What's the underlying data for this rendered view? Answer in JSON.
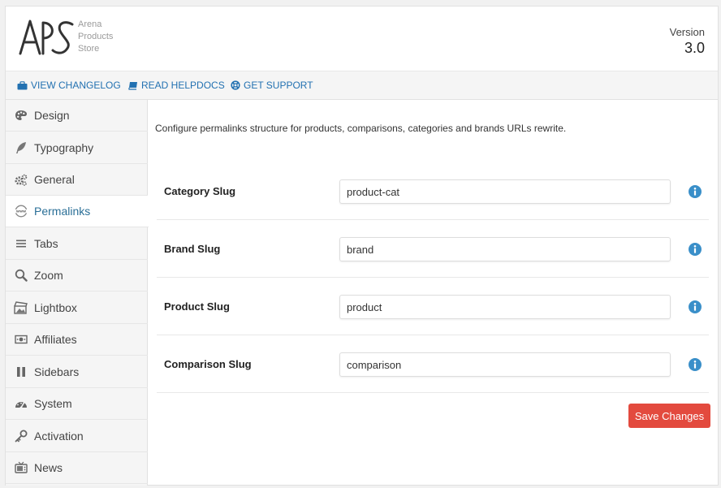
{
  "header": {
    "logo_text": [
      "Arena",
      "Products",
      "Store"
    ],
    "version_label": "Version",
    "version_number": "3.0"
  },
  "toolbar": {
    "links": [
      {
        "label": "VIEW CHANGELOG",
        "icon": "briefcase-icon"
      },
      {
        "label": "READ HELPDOCS",
        "icon": "book-icon"
      },
      {
        "label": "GET SUPPORT",
        "icon": "lifebuoy-icon"
      }
    ]
  },
  "sidebar": {
    "items": [
      {
        "label": "Design",
        "icon": "palette-icon"
      },
      {
        "label": "Typography",
        "icon": "feather-icon"
      },
      {
        "label": "General",
        "icon": "gears-icon"
      },
      {
        "label": "Permalinks",
        "icon": "www-icon",
        "active": true
      },
      {
        "label": "Tabs",
        "icon": "list-icon"
      },
      {
        "label": "Zoom",
        "icon": "magnifier-icon"
      },
      {
        "label": "Lightbox",
        "icon": "lightbox-icon"
      },
      {
        "label": "Affiliates",
        "icon": "money-icon"
      },
      {
        "label": "Sidebars",
        "icon": "columns-icon"
      },
      {
        "label": "System",
        "icon": "dashboard-icon"
      },
      {
        "label": "Activation",
        "icon": "key-icon"
      },
      {
        "label": "News",
        "icon": "tv-icon"
      }
    ]
  },
  "main": {
    "intro": "Configure permalinks structure for products, comparisons, categories and brands URLs rewrite.",
    "fields": [
      {
        "label": "Category Slug",
        "value": "product-cat"
      },
      {
        "label": "Brand Slug",
        "value": "brand"
      },
      {
        "label": "Product Slug",
        "value": "product"
      },
      {
        "label": "Comparison Slug",
        "value": "comparison"
      }
    ],
    "save_label": "Save Changes"
  },
  "colors": {
    "accent": "#2271b1",
    "active_nav": "#2a6f97",
    "save_button": "#e34a3e",
    "info_icon": "#3a8fc9"
  }
}
